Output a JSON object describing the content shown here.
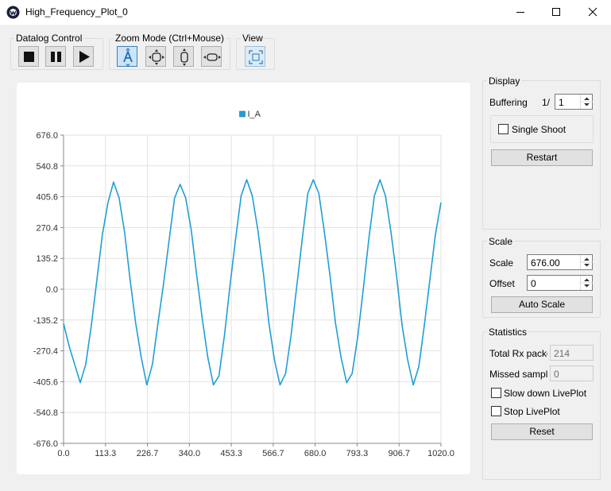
{
  "window": {
    "title": "High_Frequency_Plot_0",
    "controls": [
      "minimize",
      "maximize",
      "close"
    ]
  },
  "toolbar": {
    "datalog_label": "Datalog Control",
    "zoom_label": "Zoom Mode (Ctrl+Mouse)",
    "view_label": "View",
    "icons": [
      "stop-icon",
      "pause-icon",
      "play-icon",
      "zoom-auto-icon",
      "zoom-xy-icon",
      "zoom-vertical-icon",
      "zoom-horizontal-icon",
      "fit-view-icon"
    ]
  },
  "display": {
    "title": "Display",
    "buffering_label": "Buffering",
    "buffering_prefix": "1/",
    "buffering_value": "1",
    "single_shoot_label": "Single Shoot",
    "single_shoot_checked": false,
    "restart_label": "Restart"
  },
  "scale": {
    "title": "Scale",
    "scale_label": "Scale",
    "scale_value": "676.00",
    "offset_label": "Offset",
    "offset_value": "0",
    "auto_scale_label": "Auto Scale"
  },
  "statistics": {
    "title": "Statistics",
    "total_rx_label": "Total Rx packe",
    "total_rx_value": "214",
    "missed_label": "Missed samples",
    "missed_value": "0",
    "slow_down_label": "Slow down LivePlot",
    "slow_down_checked": false,
    "stop_label": "Stop LivePlot",
    "stop_checked": false,
    "reset_label": "Reset"
  },
  "chart_data": {
    "type": "line",
    "series": [
      {
        "name": "I_A",
        "color": "#1f9ed6",
        "x": [
          0,
          15,
          30,
          45,
          60,
          75,
          90,
          105,
          120,
          135,
          150,
          165,
          180,
          195,
          210,
          225,
          240,
          255,
          270,
          285,
          300,
          315,
          330,
          345,
          360,
          375,
          390,
          405,
          420,
          435,
          450,
          465,
          480,
          495,
          510,
          525,
          540,
          555,
          570,
          585,
          600,
          615,
          630,
          645,
          660,
          675,
          690,
          705,
          720,
          735,
          750,
          765,
          780,
          795,
          810,
          825,
          840,
          855,
          870,
          885,
          900,
          915,
          930,
          945,
          960,
          975,
          990,
          1005,
          1020
        ],
        "y": [
          -150,
          -250,
          -330,
          -410,
          -330,
          -160,
          40,
          240,
          380,
          470,
          400,
          250,
          40,
          -150,
          -300,
          -420,
          -330,
          -150,
          20,
          210,
          400,
          460,
          400,
          260,
          60,
          -130,
          -300,
          -420,
          -380,
          -200,
          20,
          220,
          410,
          480,
          410,
          260,
          70,
          -150,
          -310,
          -420,
          -370,
          -200,
          10,
          220,
          420,
          480,
          420,
          250,
          60,
          -150,
          -300,
          -410,
          -370,
          -210,
          0,
          220,
          410,
          480,
          410,
          250,
          60,
          -160,
          -310,
          -420,
          -340,
          -160,
          40,
          240,
          380
        ]
      }
    ],
    "legend": [
      "I_A"
    ],
    "x_ticks": [
      "0.0",
      "113.3",
      "226.7",
      "340.0",
      "453.3",
      "566.7",
      "680.0",
      "793.3",
      "906.7",
      "1020.0"
    ],
    "y_ticks": [
      "676.0",
      "540.8",
      "405.6",
      "270.4",
      "135.2",
      "0.0",
      "-135.2",
      "-270.4",
      "-405.6",
      "-540.8",
      "-676.0"
    ],
    "xlim": [
      0,
      1020
    ],
    "ylim": [
      -676,
      676
    ],
    "grid": true,
    "legend_position": "top-center"
  }
}
